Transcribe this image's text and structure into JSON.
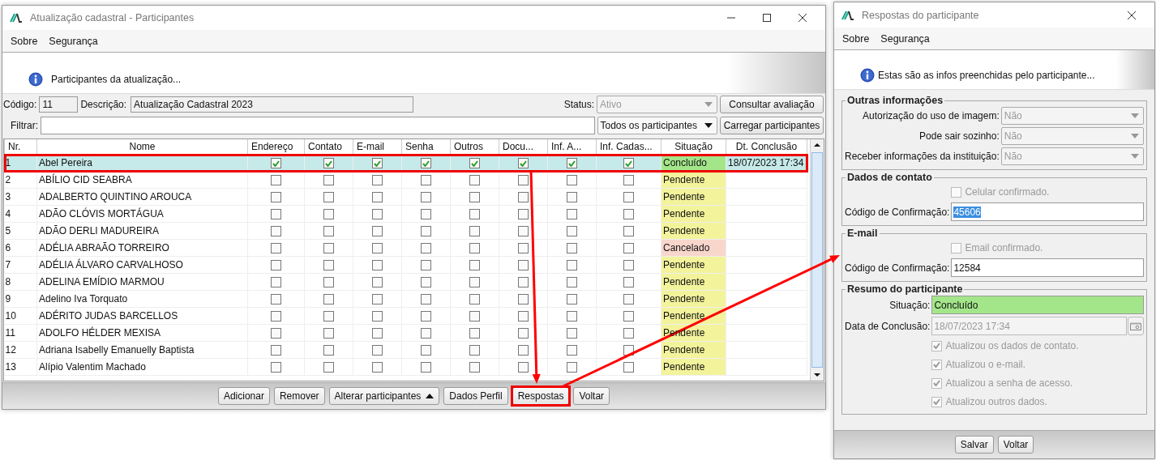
{
  "main_window": {
    "title": "Atualização cadastral - Participantes",
    "menu": [
      {
        "label": "Sobre"
      },
      {
        "label": "Segurança"
      }
    ],
    "info": "Participantes da atualização...",
    "form": {
      "code_label": "Código:",
      "code": "11",
      "description_label": "Descrição:",
      "description": "Atualização Cadastral 2023",
      "status_label": "Status:",
      "status": {
        "value": "Ativo",
        "disabled": true
      },
      "filter_label": "Filtrar:",
      "filter_option": {
        "value": "Todos os participantes",
        "disabled": false
      }
    },
    "side_buttons": [
      {
        "label": "Consultar avaliação"
      },
      {
        "label": "Carregar participantes"
      }
    ],
    "table": {
      "columns": [
        {
          "label": "Nr.",
          "kind": "number"
        },
        {
          "label": "Nome",
          "kind": "text"
        },
        {
          "label": "Endereço",
          "kind": "check"
        },
        {
          "label": "Contato",
          "kind": "check"
        },
        {
          "label": "E-mail",
          "kind": "check"
        },
        {
          "label": "Senha",
          "kind": "check"
        },
        {
          "label": "Outros",
          "kind": "check"
        },
        {
          "label": "Docu...",
          "kind": "check"
        },
        {
          "label": "Inf. A...",
          "kind": "check"
        },
        {
          "label": "Inf. Cadas...",
          "kind": "check"
        },
        {
          "label": "Situação",
          "kind": "status"
        },
        {
          "label": "Dt. Conclusão",
          "kind": "date"
        }
      ],
      "rows": [
        {
          "nr": "1",
          "name": "Abel Pereira",
          "checks": [
            true,
            true,
            true,
            true,
            true,
            true,
            true,
            true
          ],
          "status": "Concluído",
          "color": "#a3e68a",
          "date": "18/07/2023 17:34",
          "selected": true,
          "highlighted": true
        },
        {
          "nr": "2",
          "name": "ABÍLIO CID SEABRA",
          "checks": [
            false,
            false,
            false,
            false,
            false,
            false,
            false,
            false
          ],
          "status": "Pendente",
          "color": "#f3f39c",
          "selected": false,
          "highlighted": false
        },
        {
          "nr": "3",
          "name": "ADALBERTO QUINTINO AROUCA",
          "checks": [
            false,
            false,
            false,
            false,
            false,
            false,
            false,
            false
          ],
          "status": "Pendente",
          "color": "#f3f39c",
          "selected": false,
          "highlighted": false
        },
        {
          "nr": "4",
          "name": "ADÃO CLÓVIS MORTÁGUA",
          "checks": [
            false,
            false,
            false,
            false,
            false,
            false,
            false,
            false
          ],
          "status": "Pendente",
          "color": "#f3f39c",
          "selected": false,
          "highlighted": false
        },
        {
          "nr": "5",
          "name": "ADÃO DERLI MADUREIRA",
          "checks": [
            false,
            false,
            false,
            false,
            false,
            false,
            false,
            false
          ],
          "status": "Pendente",
          "color": "#f3f39c",
          "selected": false,
          "highlighted": false
        },
        {
          "nr": "6",
          "name": "ADÉLIA ABRAÃO TORREIRO",
          "checks": [
            false,
            false,
            false,
            false,
            false,
            false,
            false,
            false
          ],
          "status": "Cancelado",
          "color": "#f8d6cc",
          "selected": false,
          "highlighted": false
        },
        {
          "nr": "7",
          "name": "ADÉLIA ÁLVARO CARVALHOSO",
          "checks": [
            false,
            false,
            false,
            false,
            false,
            false,
            false,
            false
          ],
          "status": "Pendente",
          "color": "#f3f39c",
          "selected": false,
          "highlighted": false
        },
        {
          "nr": "8",
          "name": "ADELINA EMÍDIO MARMOU",
          "checks": [
            false,
            false,
            false,
            false,
            false,
            false,
            false,
            false
          ],
          "status": "Pendente",
          "color": "#f3f39c",
          "selected": false,
          "highlighted": false
        },
        {
          "nr": "9",
          "name": "Adelino Iva Torquato",
          "checks": [
            false,
            false,
            false,
            false,
            false,
            false,
            false,
            false
          ],
          "status": "Pendente",
          "color": "#f3f39c",
          "selected": false,
          "highlighted": false
        },
        {
          "nr": "10",
          "name": "ADÉRITO JUDAS BARCELLOS",
          "checks": [
            false,
            false,
            false,
            false,
            false,
            false,
            false,
            false
          ],
          "status": "Pendente",
          "color": "#f3f39c",
          "selected": false,
          "highlighted": false
        },
        {
          "nr": "11",
          "name": "ADOLFO HÉLDER MEXISA",
          "checks": [
            false,
            false,
            false,
            false,
            false,
            false,
            false,
            false
          ],
          "status": "Pendente",
          "color": "#f3f39c",
          "selected": false,
          "highlighted": false
        },
        {
          "nr": "12",
          "name": "Adriana Isabelly Emanuelly Baptista",
          "checks": [
            false,
            false,
            false,
            false,
            false,
            false,
            false,
            false
          ],
          "status": "Pendente",
          "color": "#f3f39c",
          "selected": false,
          "highlighted": false
        },
        {
          "nr": "13",
          "name": "Alípio Valentim Machado",
          "checks": [
            false,
            false,
            false,
            false,
            false,
            false,
            false,
            false
          ],
          "status": "Pendente",
          "color": "#f3f39c",
          "selected": false,
          "highlighted": false
        }
      ]
    },
    "buttons": [
      {
        "label": "Adicionar",
        "kind": "plain",
        "highlighted": false
      },
      {
        "label": "Remover",
        "kind": "plain",
        "highlighted": false
      },
      {
        "label": "Alterar participantes",
        "kind": "menu",
        "highlighted": false
      },
      {
        "label": "Dados Perfil",
        "kind": "plain",
        "highlighted": false
      },
      {
        "label": "Respostas",
        "kind": "plain",
        "highlighted": true
      },
      {
        "label": "Voltar",
        "kind": "plain",
        "highlighted": false
      }
    ]
  },
  "detail_window": {
    "title": "Respostas do participante",
    "menu": [
      {
        "label": "Sobre"
      },
      {
        "label": "Segurança"
      }
    ],
    "info": "Estas são as infos preenchidas pelo participante...",
    "groups": [
      {
        "title": "Outras informações",
        "items": [
          {
            "kind": "combo",
            "label": "Autorização do uso de imagem:",
            "value": "Não",
            "disabled": true
          },
          {
            "kind": "combo",
            "label": "Pode sair sozinho:",
            "value": "Não",
            "disabled": true
          },
          {
            "kind": "combo",
            "label": "Receber informações da instituição:",
            "value": "Não",
            "disabled": true
          }
        ]
      },
      {
        "title": "Dados de contato",
        "items": [
          {
            "kind": "checkbox",
            "label": "Celular confirmado.",
            "checked": false,
            "disabled": true
          },
          {
            "kind": "text",
            "label": "Código de Confirmação:",
            "value": "45606",
            "text_selected": true
          }
        ]
      },
      {
        "title": "E-mail",
        "items": [
          {
            "kind": "checkbox",
            "label": "Email confirmado.",
            "checked": false,
            "disabled": true
          },
          {
            "kind": "text",
            "label": "Código de Confirmação:",
            "value": "12584",
            "text_selected": false
          }
        ]
      },
      {
        "title": "Resumo do participante",
        "items": [
          {
            "kind": "status",
            "label": "Situação:",
            "value": "Concluído",
            "color": "#a3e68a"
          },
          {
            "kind": "date",
            "label": "Data de Conclusão:",
            "value": "18/07/2023 17:34",
            "disabled": true
          },
          {
            "kind": "checkbox",
            "label": "Atualizou os dados de contato.",
            "checked": true,
            "disabled": true
          },
          {
            "kind": "checkbox",
            "label": "Atualizou o e-mail.",
            "checked": true,
            "disabled": true
          },
          {
            "kind": "checkbox",
            "label": "Atualizou a senha de acesso.",
            "checked": true,
            "disabled": true
          },
          {
            "kind": "checkbox",
            "label": "Atualizou outros dados.",
            "checked": true,
            "disabled": true
          }
        ]
      }
    ],
    "buttons": [
      {
        "label": "Salvar"
      },
      {
        "label": "Voltar"
      }
    ]
  }
}
